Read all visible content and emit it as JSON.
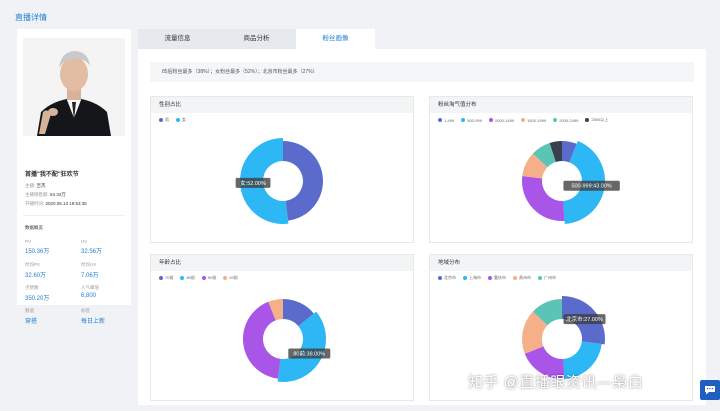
{
  "page_title": "直播详情",
  "host": {
    "name": "首播\"我不配\"狂欢节",
    "anchor_label": "主播:",
    "anchor_value": "吉杰",
    "gmv_label": "主播销售额:",
    "gmv_value": "63.32万",
    "start_label": "开播时间:",
    "start_value": "2020.05.13 19:53:35"
  },
  "overview": {
    "title": "数据概览",
    "stats": [
      {
        "label": "PV",
        "value": "150.36万"
      },
      {
        "label": "UV",
        "value": "32.56万"
      },
      {
        "label": "时均PV",
        "value": "32.60万"
      },
      {
        "label": "时均UV",
        "value": "7.06万"
      },
      {
        "label": "点赞数",
        "value": "350.20万"
      },
      {
        "label": "人气峰值",
        "value": "6,800"
      },
      {
        "label": "频道",
        "value": "穿搭"
      },
      {
        "label": "标签",
        "value": "每日上新"
      }
    ]
  },
  "tabs": [
    {
      "label": "流量信息"
    },
    {
      "label": "商品分析"
    },
    {
      "label": "粉丝画像"
    }
  ],
  "summary_text": "85后粉丝最多（38%）；女粉丝最多（52%）；北京市粉丝最多（27%）",
  "chart_data": [
    {
      "type": "pie",
      "title": "性别占比",
      "categories": [
        "男",
        "女"
      ],
      "values": [
        48,
        52
      ],
      "colors": [
        "#5b6bcc",
        "#2db7f5"
      ],
      "tooltip": "女:52.00%",
      "tooltip_index": 1
    },
    {
      "type": "pie",
      "title": "粉丝淘气值分布",
      "categories": [
        "1-499",
        "500-999",
        "1000-1499",
        "1500-1999",
        "2000-2499",
        "2500以上"
      ],
      "values": [
        6,
        43,
        28,
        10,
        8,
        5
      ],
      "colors": [
        "#5b6bcc",
        "#2db7f5",
        "#a855e8",
        "#f5b08a",
        "#5bc4b5",
        "#3a3f4d"
      ],
      "tooltip": "500-999:43.00%",
      "tooltip_index": 1
    },
    {
      "type": "pie",
      "title": "年龄占比",
      "categories": [
        "70前",
        "80前",
        "90前",
        "00前"
      ],
      "values": [
        14,
        38,
        42,
        6
      ],
      "colors": [
        "#5b6bcc",
        "#2db7f5",
        "#a855e8",
        "#f5b08a"
      ],
      "tooltip": "80前:38.00%",
      "tooltip_index": 1
    },
    {
      "type": "pie",
      "title": "地域分布",
      "categories": [
        "北京市",
        "上海市",
        "重庆市",
        "贵州市",
        "广州市"
      ],
      "values": [
        27,
        22,
        20,
        18,
        13
      ],
      "colors": [
        "#5b6bcc",
        "#2db7f5",
        "#a855e8",
        "#f5b08a",
        "#5bc4b5"
      ],
      "tooltip": "北京市:27.00%",
      "tooltip_index": 0
    }
  ],
  "watermark": "知乎 @直播眼资讯—枭白"
}
